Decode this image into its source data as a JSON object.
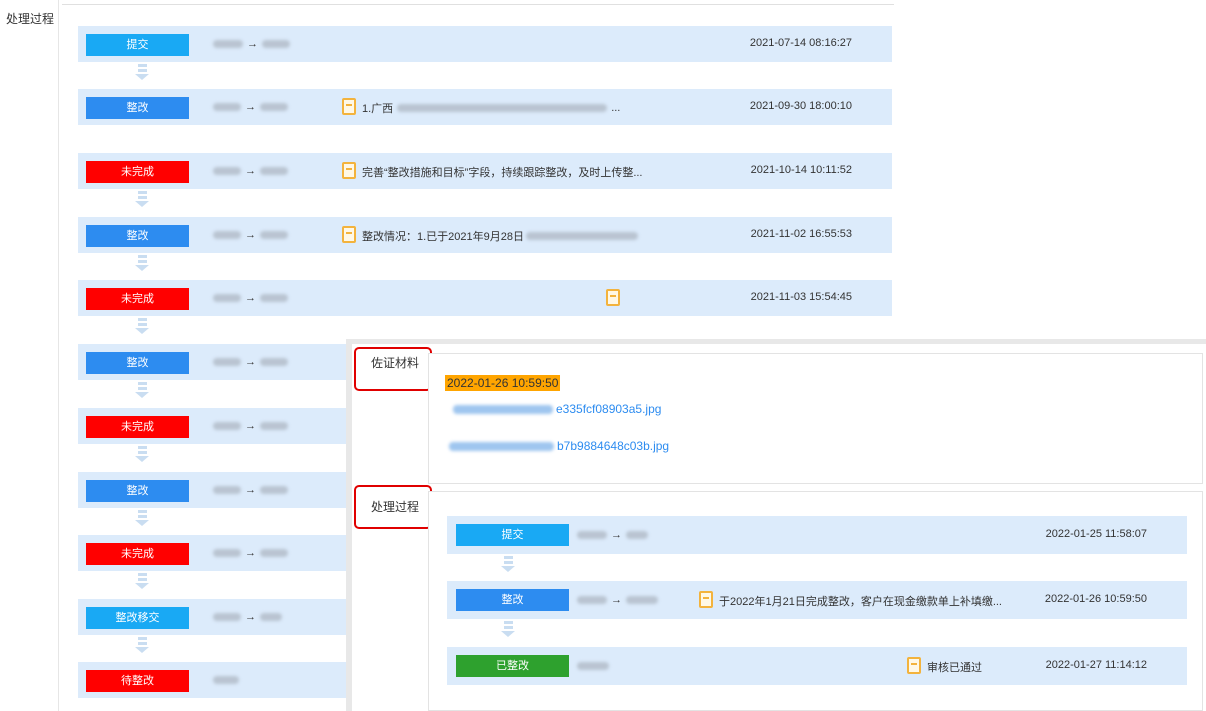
{
  "page": {
    "left_label": "处理过程"
  },
  "process": [
    {
      "badge": "提交",
      "color": "cyan",
      "names": {
        "from": "",
        "to": ""
      },
      "note": "",
      "time": "2021-07-14 08:16:27"
    },
    {
      "badge": "整改",
      "color": "blue",
      "names": {
        "from": "",
        "to": ""
      },
      "note": "1.广西",
      "note_tail": "...",
      "time": "2021-09-30 18:00:10"
    },
    {
      "badge": "未完成",
      "color": "red",
      "names": {
        "from": "",
        "to": ""
      },
      "note": "完善“整改措施和目标”字段，持续跟踪整改，及时上传整...",
      "time": "2021-10-14 10:11:52"
    },
    {
      "badge": "整改",
      "color": "blue",
      "names": {
        "from": "",
        "to": ""
      },
      "note": "整改情况：1.已于2021年9月28日",
      "time": "2021-11-02 16:55:53"
    },
    {
      "badge": "未完成",
      "color": "red",
      "names": {
        "from": "",
        "to": ""
      },
      "note": "",
      "time": "2021-11-03 15:54:45"
    },
    {
      "badge": "整改",
      "color": "blue",
      "names": {
        "from": "",
        "to": ""
      }
    },
    {
      "badge": "未完成",
      "color": "red",
      "names": {
        "from": "",
        "to": ""
      }
    },
    {
      "badge": "整改",
      "color": "blue",
      "names": {
        "from": "",
        "to": ""
      }
    },
    {
      "badge": "未完成",
      "color": "red",
      "names": {
        "from": "",
        "to": ""
      }
    },
    {
      "badge": "整改移交",
      "color": "cyan",
      "names": {
        "from": "",
        "to": ""
      }
    },
    {
      "badge": "待整改",
      "color": "red",
      "names": {
        "from": ""
      }
    }
  ],
  "popup": {
    "evidence_label": "佐证材料",
    "evidence_timestamp": "2022-01-26 10:59:50",
    "files": [
      {
        "suffix": "e335fcf08903a5.jpg"
      },
      {
        "suffix": "b7b9884648c03b.jpg"
      }
    ],
    "process_label": "处理过程",
    "process": [
      {
        "badge": "提交",
        "color": "cyan",
        "note": "",
        "time": "2022-01-25 11:58:07"
      },
      {
        "badge": "整改",
        "color": "blue",
        "note": "于2022年1月21日完成整改，客户在现金缴款单上补填缴...",
        "time": "2022-01-26 10:59:50"
      },
      {
        "badge": "已整改",
        "color": "green",
        "note": "审核已通过",
        "time": "2022-01-27 11:14:12"
      }
    ]
  },
  "colors": {
    "blue": "#2d8cf0",
    "cyan": "#19a9f4",
    "red": "#ff0000",
    "green": "#2ea12e",
    "row_bg": "#dcebfb",
    "highlight": "#ffa500",
    "annotation_red": "#e00000"
  }
}
